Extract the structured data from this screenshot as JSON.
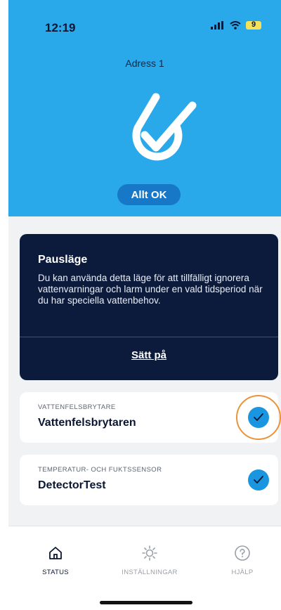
{
  "status_bar": {
    "time": "12:19",
    "battery": "9"
  },
  "header": {
    "address": "Adress 1",
    "status_label": "Allt OK"
  },
  "pause_card": {
    "title": "Pausläge",
    "text": "Du kan använda detta läge för att tillfälligt ignorera vattenvarningar och larm under en vald tidsperiod när du har speciella vattenbehov.",
    "action": "Sätt på"
  },
  "devices": [
    {
      "category": "VATTENFELSBRYTARE",
      "name": "Vattenfelsbrytaren",
      "status": "ok"
    },
    {
      "category": "TEMPERATUR- OCH FUKTSSENSOR",
      "name": "DetectorTest",
      "status": "ok"
    }
  ],
  "tabbar": {
    "status": "STATUS",
    "settings": "INSTÄLLNINGAR",
    "help": "HJÄLP"
  },
  "colors": {
    "hero": "#29a8ea",
    "pause_card": "#0c1a3c",
    "check": "#1a96e0",
    "highlight": "#e9943a"
  }
}
